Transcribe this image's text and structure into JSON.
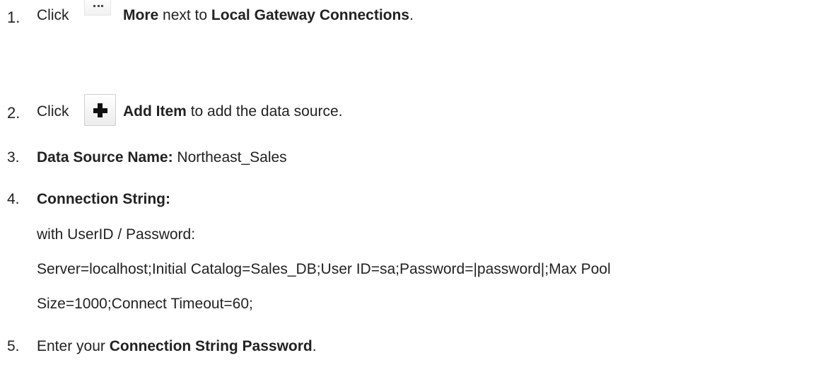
{
  "steps": [
    {
      "number": "1.",
      "prefix": "Click",
      "icon": "more-icon",
      "bold1": "More",
      "mid": "next to",
      "bold2": "Local Gateway Connections",
      "suffix": "."
    },
    {
      "number": "2.",
      "prefix": "Click",
      "icon": "add-icon",
      "bold1": "Add Item",
      "suffix": "to add the data source."
    },
    {
      "number": "3.",
      "label": "Data Source Name:",
      "value": "Northeast_Sales"
    },
    {
      "number": "4.",
      "label": "Connection String:",
      "line1": "with UserID / Password:",
      "line2": "Server=localhost;Initial Catalog=Sales_DB;User ID=sa;Password=|password|;Max Pool",
      "line3": "Size=1000;Connect Timeout=60;"
    },
    {
      "number": "5.",
      "prefix": "Enter your",
      "bold1": "Connection String Password",
      "suffix": "."
    }
  ]
}
